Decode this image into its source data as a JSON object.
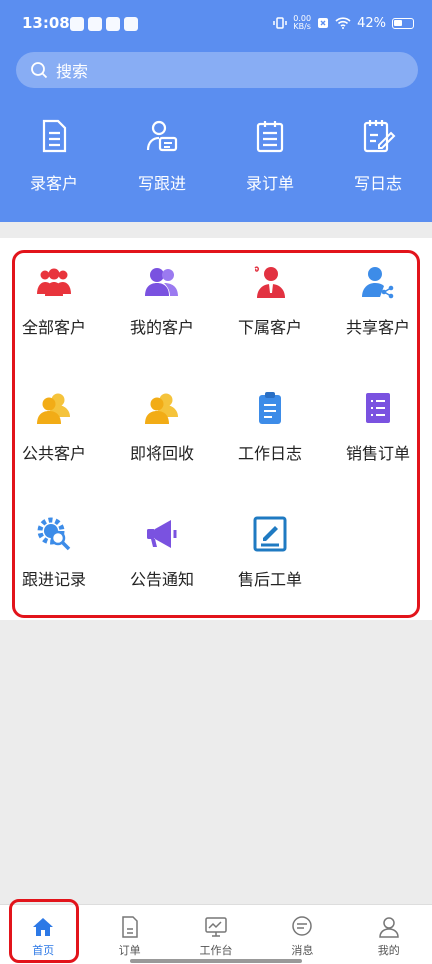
{
  "status_bar": {
    "time": "13:08",
    "net_speed": "0.00",
    "net_unit": "KB/s",
    "battery": "42%"
  },
  "search": {
    "placeholder": "搜索"
  },
  "quick_actions": [
    {
      "label": "录客户",
      "icon": "document-icon"
    },
    {
      "label": "写跟进",
      "icon": "user-card-icon"
    },
    {
      "label": "录订单",
      "icon": "clipboard-icon"
    },
    {
      "label": "写日志",
      "icon": "edit-note-icon"
    }
  ],
  "grid": [
    {
      "label": "全部客户",
      "icon": "group-icon",
      "color": "#e8343c"
    },
    {
      "label": "我的客户",
      "icon": "users-icon",
      "color": "#7a52e0"
    },
    {
      "label": "下属客户",
      "icon": "person-tie-icon",
      "color": "#e23241"
    },
    {
      "label": "共享客户",
      "icon": "share-user-icon",
      "color": "#3d8ce8"
    },
    {
      "label": "公共客户",
      "icon": "users-icon",
      "color": "#f2ac16"
    },
    {
      "label": "即将回收",
      "icon": "users-icon",
      "color": "#f2ac16"
    },
    {
      "label": "工作日志",
      "icon": "clipboard-icon",
      "color": "#3d8ce8"
    },
    {
      "label": "销售订单",
      "icon": "list-icon",
      "color": "#7a52e0"
    },
    {
      "label": "跟进记录",
      "icon": "gear-search-icon",
      "color": "#3d8ce8"
    },
    {
      "label": "公告通知",
      "icon": "megaphone-icon",
      "color": "#7a52e0"
    },
    {
      "label": "售后工单",
      "icon": "edit-box-icon",
      "color": "#1f7ac2"
    }
  ],
  "tabbar": [
    {
      "label": "首页",
      "icon": "home-icon",
      "active": true
    },
    {
      "label": "订单",
      "icon": "order-icon",
      "active": false
    },
    {
      "label": "工作台",
      "icon": "monitor-icon",
      "active": false
    },
    {
      "label": "消息",
      "icon": "chat-icon",
      "active": false
    },
    {
      "label": "我的",
      "icon": "user-icon",
      "active": false
    }
  ],
  "colors": {
    "header": "#5b8ef0",
    "highlight_outline": "#e2141b",
    "tab_active": "#2d79e6"
  }
}
